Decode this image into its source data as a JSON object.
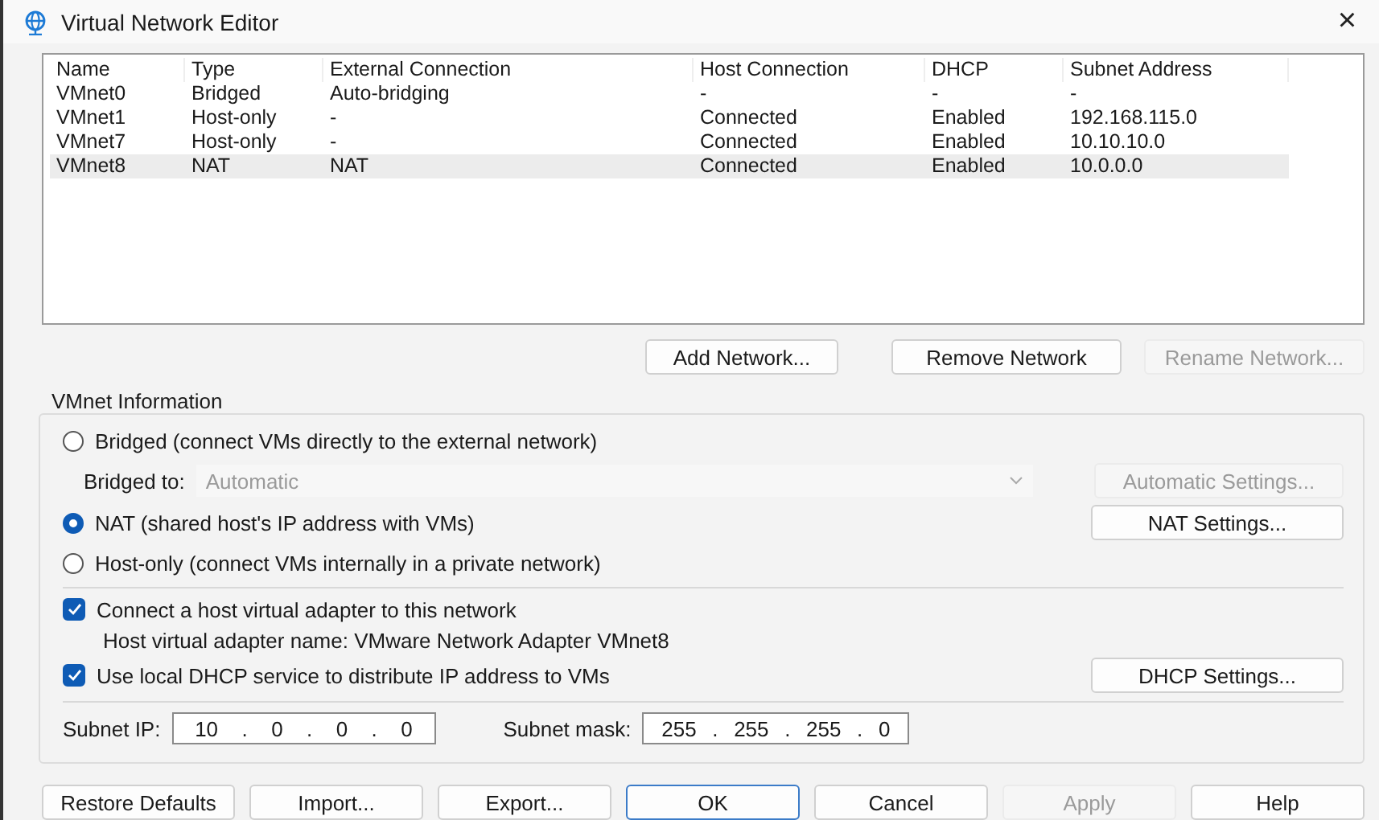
{
  "window": {
    "title": "Virtual Network Editor",
    "close": "×"
  },
  "table": {
    "columns": [
      "Name",
      "Type",
      "External Connection",
      "Host Connection",
      "DHCP",
      "Subnet Address"
    ],
    "rows": [
      {
        "cells": [
          "VMnet0",
          "Bridged",
          "Auto-bridging",
          "-",
          "-",
          "-"
        ],
        "selected": false
      },
      {
        "cells": [
          "VMnet1",
          "Host-only",
          "-",
          "Connected",
          "Enabled",
          "192.168.115.0"
        ],
        "selected": false
      },
      {
        "cells": [
          "VMnet7",
          "Host-only",
          "-",
          "Connected",
          "Enabled",
          "10.10.10.0"
        ],
        "selected": false
      },
      {
        "cells": [
          "VMnet8",
          "NAT",
          "NAT",
          "Connected",
          "Enabled",
          "10.0.0.0"
        ],
        "selected": true
      }
    ]
  },
  "network_buttons": [
    {
      "label": "Add Network...",
      "disabled": false
    },
    {
      "label": "Remove Network",
      "disabled": false
    },
    {
      "label": "Rename Network...",
      "disabled": true
    }
  ],
  "vmnet_information": {
    "title": "VMnet Information",
    "bridged": {
      "label": "Bridged (connect VMs directly to the external network)",
      "selected": false
    },
    "bridged_to": {
      "label": "Bridged to:",
      "value": "Automatic",
      "disabled": true,
      "button": {
        "label": "Automatic Settings...",
        "disabled": true
      }
    },
    "nat": {
      "label": "NAT (shared host's IP address with VMs)",
      "selected": true,
      "button": {
        "label": "NAT Settings...",
        "disabled": false
      }
    },
    "host_only": {
      "label": "Host-only (connect VMs internally in a private network)",
      "selected": false
    },
    "connect_adapter": {
      "label": "Connect a host virtual adapter to this network",
      "checked": true
    },
    "adapter_name": "Host virtual adapter name: VMware Network Adapter VMnet8",
    "use_dhcp": {
      "label": "Use local DHCP service to distribute IP address to VMs",
      "checked": true,
      "button": {
        "label": "DHCP Settings...",
        "disabled": false
      }
    },
    "subnet_ip": {
      "label": "Subnet IP:",
      "octets": [
        "10",
        "0",
        "0",
        "0"
      ],
      "separator": "."
    },
    "subnet_mask": {
      "label": "Subnet mask:",
      "octets": [
        "255",
        "255",
        "255",
        "0"
      ],
      "separator": "."
    }
  },
  "footer_buttons": [
    {
      "label": "Restore Defaults",
      "disabled": false,
      "kind": "normal"
    },
    {
      "label": "Import...",
      "disabled": false,
      "kind": "normal"
    },
    {
      "label": "Export...",
      "disabled": false,
      "kind": "normal"
    },
    {
      "label": "OK",
      "disabled": false,
      "kind": "default"
    },
    {
      "label": "Cancel",
      "disabled": false,
      "kind": "normal"
    },
    {
      "label": "Apply",
      "disabled": true,
      "kind": "normal"
    },
    {
      "label": "Help",
      "disabled": false,
      "kind": "normal"
    }
  ]
}
